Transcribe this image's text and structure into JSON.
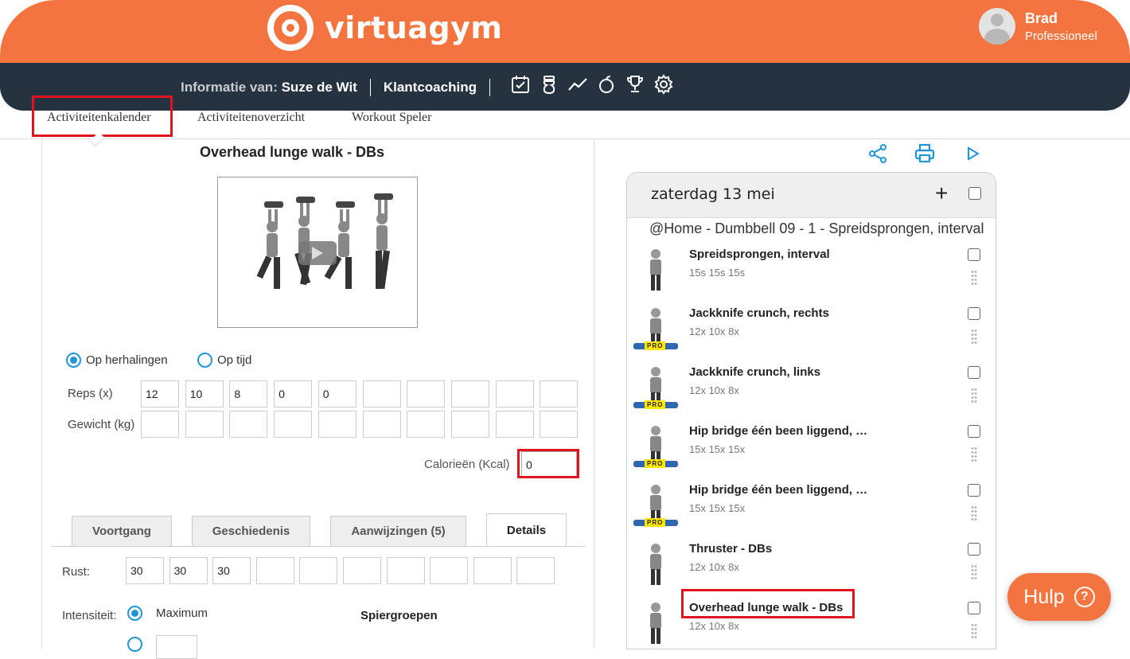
{
  "brand": {
    "name": "virtuagym",
    "primary_color": "#f4743f",
    "dark_color": "#253341",
    "accent_color": "#2196d6",
    "highlight_color": "#e0141e"
  },
  "user": {
    "name": "Brad",
    "role": "Professioneel"
  },
  "infobar": {
    "prefix": "Informatie van:",
    "client": "Suze de Wit",
    "coaching": "Klantcoaching",
    "icons": [
      "calendar-check-icon",
      "bottle-icon",
      "chart-line-icon",
      "apple-icon",
      "trophy-icon",
      "gear-icon"
    ]
  },
  "subnav": {
    "items": [
      "Activiteitenkalender",
      "Activiteitenoverzicht",
      "Workout Speler"
    ]
  },
  "exercise": {
    "title": "Overhead lunge walk - DBs",
    "mode_options": [
      "Op herhalingen",
      "Op tijd"
    ],
    "reps_label": "Reps (x)",
    "reps": [
      "12",
      "10",
      "8",
      "0",
      "0",
      "",
      "",
      "",
      "",
      ""
    ],
    "weight_label": "Gewicht (kg)",
    "weights": [
      "",
      "",
      "",
      "",
      "",
      "",
      "",
      "",
      "",
      ""
    ],
    "calories_label": "Calorieën (Kcal)",
    "calories": "0",
    "tabs": [
      "Voortgang",
      "Geschiedenis",
      "Aanwijzingen (5)",
      "Details"
    ],
    "rest_label": "Rust:",
    "rest": [
      "30",
      "30",
      "30",
      "",
      "",
      "",
      "",
      "",
      "",
      ""
    ],
    "intensity_label": "Intensiteit:",
    "intensity_value": "Maximum",
    "muscles_label": "Spiergroepen"
  },
  "day": {
    "title": "zaterdag 13 mei",
    "workout": "@Home - Dumbbell 09 - 1 - Spreidsprongen, interval",
    "items": [
      {
        "name": "Spreidsprongen, interval",
        "sets": "15s 15s 15s",
        "pro": ""
      },
      {
        "name": "Jackknife crunch, rechts",
        "sets": "12x 10x 8x",
        "pro": "PRO"
      },
      {
        "name": "Jackknife crunch, links",
        "sets": "12x 10x 8x",
        "pro": "PRO"
      },
      {
        "name": "Hip bridge één been liggend, …",
        "sets": "15x 15x 15x",
        "pro": "PRO"
      },
      {
        "name": "Hip bridge één been liggend, …",
        "sets": "15x 15x 15x",
        "pro": "PRO"
      },
      {
        "name": "Thruster - DBs",
        "sets": "12x 10x 8x",
        "pro": ""
      },
      {
        "name": "Overhead lunge walk - DBs",
        "sets": "12x 10x 8x",
        "pro": ""
      }
    ]
  },
  "help": {
    "label": "Hulp",
    "glyph": "?"
  }
}
